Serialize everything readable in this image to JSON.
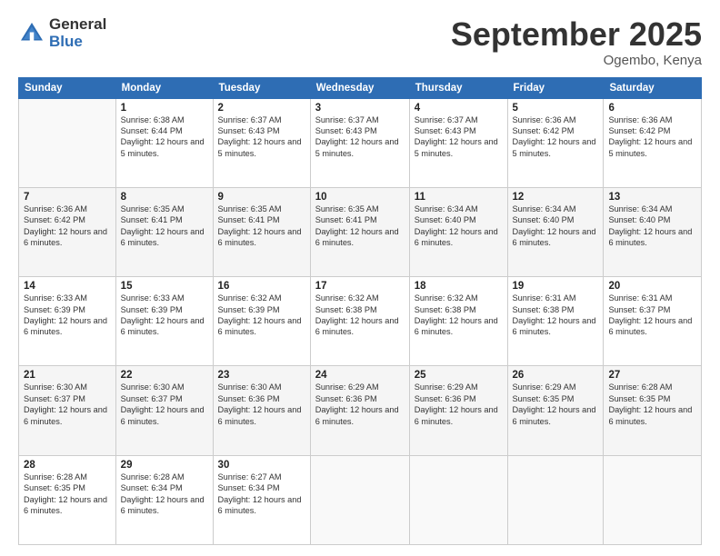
{
  "header": {
    "logo_general": "General",
    "logo_blue": "Blue",
    "month_title": "September 2025",
    "location": "Ogembo, Kenya"
  },
  "days_of_week": [
    "Sunday",
    "Monday",
    "Tuesday",
    "Wednesday",
    "Thursday",
    "Friday",
    "Saturday"
  ],
  "weeks": [
    [
      {
        "day": "",
        "info": ""
      },
      {
        "day": "1",
        "info": "Sunrise: 6:38 AM\nSunset: 6:44 PM\nDaylight: 12 hours\nand 5 minutes."
      },
      {
        "day": "2",
        "info": "Sunrise: 6:37 AM\nSunset: 6:43 PM\nDaylight: 12 hours\nand 5 minutes."
      },
      {
        "day": "3",
        "info": "Sunrise: 6:37 AM\nSunset: 6:43 PM\nDaylight: 12 hours\nand 5 minutes."
      },
      {
        "day": "4",
        "info": "Sunrise: 6:37 AM\nSunset: 6:43 PM\nDaylight: 12 hours\nand 5 minutes."
      },
      {
        "day": "5",
        "info": "Sunrise: 6:36 AM\nSunset: 6:42 PM\nDaylight: 12 hours\nand 5 minutes."
      },
      {
        "day": "6",
        "info": "Sunrise: 6:36 AM\nSunset: 6:42 PM\nDaylight: 12 hours\nand 5 minutes."
      }
    ],
    [
      {
        "day": "7",
        "info": "Sunrise: 6:36 AM\nSunset: 6:42 PM\nDaylight: 12 hours\nand 6 minutes."
      },
      {
        "day": "8",
        "info": "Sunrise: 6:35 AM\nSunset: 6:41 PM\nDaylight: 12 hours\nand 6 minutes."
      },
      {
        "day": "9",
        "info": "Sunrise: 6:35 AM\nSunset: 6:41 PM\nDaylight: 12 hours\nand 6 minutes."
      },
      {
        "day": "10",
        "info": "Sunrise: 6:35 AM\nSunset: 6:41 PM\nDaylight: 12 hours\nand 6 minutes."
      },
      {
        "day": "11",
        "info": "Sunrise: 6:34 AM\nSunset: 6:40 PM\nDaylight: 12 hours\nand 6 minutes."
      },
      {
        "day": "12",
        "info": "Sunrise: 6:34 AM\nSunset: 6:40 PM\nDaylight: 12 hours\nand 6 minutes."
      },
      {
        "day": "13",
        "info": "Sunrise: 6:34 AM\nSunset: 6:40 PM\nDaylight: 12 hours\nand 6 minutes."
      }
    ],
    [
      {
        "day": "14",
        "info": "Sunrise: 6:33 AM\nSunset: 6:39 PM\nDaylight: 12 hours\nand 6 minutes."
      },
      {
        "day": "15",
        "info": "Sunrise: 6:33 AM\nSunset: 6:39 PM\nDaylight: 12 hours\nand 6 minutes."
      },
      {
        "day": "16",
        "info": "Sunrise: 6:32 AM\nSunset: 6:39 PM\nDaylight: 12 hours\nand 6 minutes."
      },
      {
        "day": "17",
        "info": "Sunrise: 6:32 AM\nSunset: 6:38 PM\nDaylight: 12 hours\nand 6 minutes."
      },
      {
        "day": "18",
        "info": "Sunrise: 6:32 AM\nSunset: 6:38 PM\nDaylight: 12 hours\nand 6 minutes."
      },
      {
        "day": "19",
        "info": "Sunrise: 6:31 AM\nSunset: 6:38 PM\nDaylight: 12 hours\nand 6 minutes."
      },
      {
        "day": "20",
        "info": "Sunrise: 6:31 AM\nSunset: 6:37 PM\nDaylight: 12 hours\nand 6 minutes."
      }
    ],
    [
      {
        "day": "21",
        "info": "Sunrise: 6:30 AM\nSunset: 6:37 PM\nDaylight: 12 hours\nand 6 minutes."
      },
      {
        "day": "22",
        "info": "Sunrise: 6:30 AM\nSunset: 6:37 PM\nDaylight: 12 hours\nand 6 minutes."
      },
      {
        "day": "23",
        "info": "Sunrise: 6:30 AM\nSunset: 6:36 PM\nDaylight: 12 hours\nand 6 minutes."
      },
      {
        "day": "24",
        "info": "Sunrise: 6:29 AM\nSunset: 6:36 PM\nDaylight: 12 hours\nand 6 minutes."
      },
      {
        "day": "25",
        "info": "Sunrise: 6:29 AM\nSunset: 6:36 PM\nDaylight: 12 hours\nand 6 minutes."
      },
      {
        "day": "26",
        "info": "Sunrise: 6:29 AM\nSunset: 6:35 PM\nDaylight: 12 hours\nand 6 minutes."
      },
      {
        "day": "27",
        "info": "Sunrise: 6:28 AM\nSunset: 6:35 PM\nDaylight: 12 hours\nand 6 minutes."
      }
    ],
    [
      {
        "day": "28",
        "info": "Sunrise: 6:28 AM\nSunset: 6:35 PM\nDaylight: 12 hours\nand 6 minutes."
      },
      {
        "day": "29",
        "info": "Sunrise: 6:28 AM\nSunset: 6:34 PM\nDaylight: 12 hours\nand 6 minutes."
      },
      {
        "day": "30",
        "info": "Sunrise: 6:27 AM\nSunset: 6:34 PM\nDaylight: 12 hours\nand 6 minutes."
      },
      {
        "day": "",
        "info": ""
      },
      {
        "day": "",
        "info": ""
      },
      {
        "day": "",
        "info": ""
      },
      {
        "day": "",
        "info": ""
      }
    ]
  ]
}
